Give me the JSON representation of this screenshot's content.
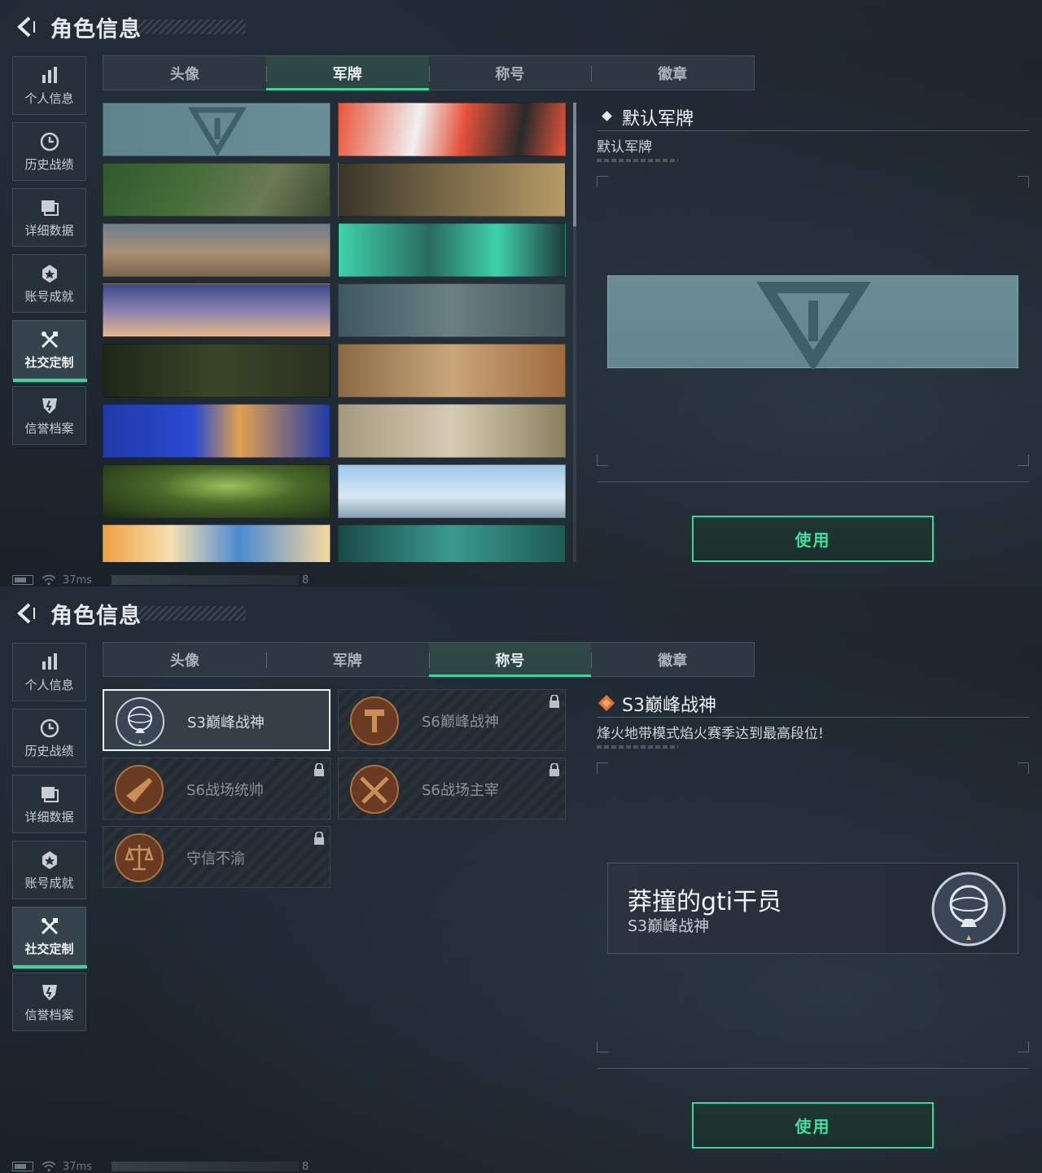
{
  "header": {
    "title": "角色信息"
  },
  "sidebar": {
    "items": [
      {
        "label": "个人信息",
        "icon": "bar-chart-icon"
      },
      {
        "label": "历史战绩",
        "icon": "history-clock-icon"
      },
      {
        "label": "详细数据",
        "icon": "document-stack-icon"
      },
      {
        "label": "账号成就",
        "icon": "achievement-icon"
      },
      {
        "label": "社交定制",
        "icon": "tools-icon"
      },
      {
        "label": "信誉档案",
        "icon": "shield-icon"
      }
    ],
    "active_index": 4
  },
  "tabs": [
    "头像",
    "军牌",
    "称号",
    "徽章"
  ],
  "screen1": {
    "active_tab": "军牌",
    "detail": {
      "title": "默认军牌",
      "description": "默认军牌"
    },
    "use_button": "使用",
    "status": {
      "ping": "37ms",
      "number": "8"
    }
  },
  "screen2": {
    "active_tab": "称号",
    "titles": [
      {
        "name": "S3巅峰战神",
        "locked": false,
        "selected": true
      },
      {
        "name": "S6巅峰战神",
        "locked": true,
        "selected": false
      },
      {
        "name": "S6战场统帅",
        "locked": true,
        "selected": false
      },
      {
        "name": "S6战场主宰",
        "locked": true,
        "selected": false
      },
      {
        "name": "守信不渝",
        "locked": true,
        "selected": false
      }
    ],
    "detail": {
      "title": "S3巅峰战神",
      "description": "烽火地带模式焰火赛季达到最高段位!"
    },
    "nameplate": {
      "player_name": "莽撞的gti干员",
      "title": "S3巅峰战神"
    },
    "use_button": "使用",
    "status": {
      "ping": "37ms",
      "number": "8"
    }
  },
  "colors": {
    "accent": "#3fd29a",
    "background": "#1c242c",
    "selected_border": "#f0f2f4"
  }
}
